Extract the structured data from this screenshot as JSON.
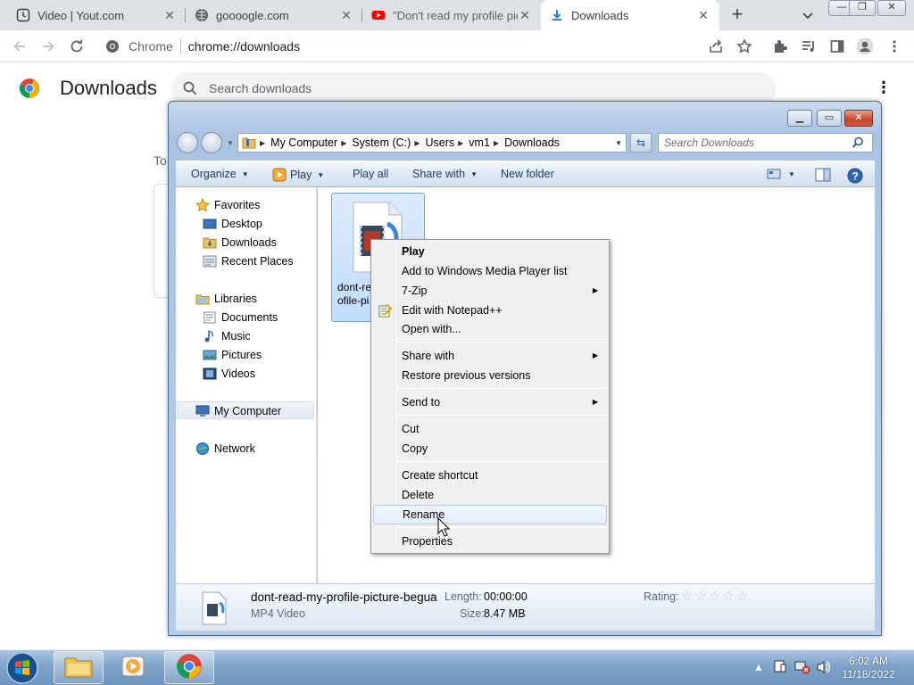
{
  "tabs": [
    {
      "label": "Video | Yout.com",
      "icon": "clock-icon"
    },
    {
      "label": "goooogle.com",
      "icon": "globe-icon"
    },
    {
      "label": "\"Don't read my profile pic",
      "icon": "youtube-icon"
    },
    {
      "label": "Downloads",
      "icon": "download-icon"
    }
  ],
  "toolbar": {
    "omnibox_site": "Chrome",
    "omnibox_url": "chrome://downloads"
  },
  "downloads_page": {
    "title": "Downloads",
    "search_placeholder": "Search downloads",
    "section_partial": "To"
  },
  "explorer": {
    "breadcrumbs": [
      "My Computer",
      "System (C:)",
      "Users",
      "vm1",
      "Downloads"
    ],
    "search_placeholder": "Search Downloads",
    "commands": {
      "organize": "Organize",
      "play": "Play",
      "play_all": "Play all",
      "share_with": "Share with",
      "new_folder": "New folder"
    },
    "nav": {
      "favorites": "Favorites",
      "desktop": "Desktop",
      "downloads": "Downloads",
      "recent_places": "Recent Places",
      "libraries": "Libraries",
      "documents": "Documents",
      "music": "Music",
      "pictures": "Pictures",
      "videos": "Videos",
      "my_computer": "My Computer",
      "network": "Network"
    },
    "file": {
      "name_line1": "dont-re",
      "name_line2": "ofile-pi"
    },
    "details": {
      "filename": "dont-read-my-profile-picture-begua",
      "type": "MP4 Video",
      "length_label": "Length:",
      "length_value": "00:00:00",
      "size_label": "Size:",
      "size_value": "8.47 MB",
      "rating_label": "Rating:",
      "rating_value": 0
    }
  },
  "context_menu": {
    "play": "Play",
    "add_wmp": "Add to Windows Media Player list",
    "seven_zip": "7-Zip",
    "notepad": "Edit with Notepad++",
    "open_with": "Open with...",
    "share_with": "Share with",
    "restore": "Restore previous versions",
    "send_to": "Send to",
    "cut": "Cut",
    "copy": "Copy",
    "create_shortcut": "Create shortcut",
    "delete": "Delete",
    "rename": "Rename",
    "properties": "Properties"
  },
  "taskbar": {
    "time": "6:02 AM",
    "date": "11/18/2022"
  },
  "colors": {
    "chrome_tabstrip": "#dee1e6",
    "explorer_frame": "#b6cde7",
    "taskbar": "#7ea3c9",
    "menu_hover": "#aeccf1"
  }
}
